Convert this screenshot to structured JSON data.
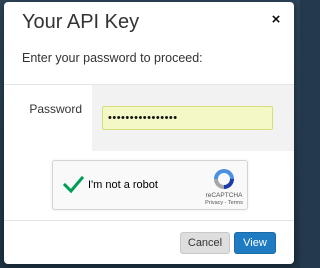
{
  "modal": {
    "title": "Your API Key",
    "close_label": "×",
    "subtitle": "Enter your password to proceed:"
  },
  "form": {
    "password_label": "Password",
    "password_value": "••••••••••••••••"
  },
  "captcha": {
    "label": "I'm not a robot",
    "brand": "reCAPTCHA",
    "links": "Privacy - Terms",
    "checked": true,
    "check_color": "#009e55"
  },
  "actions": {
    "cancel_label": "Cancel",
    "view_label": "View",
    "primary_color": "#1f7cc2"
  }
}
